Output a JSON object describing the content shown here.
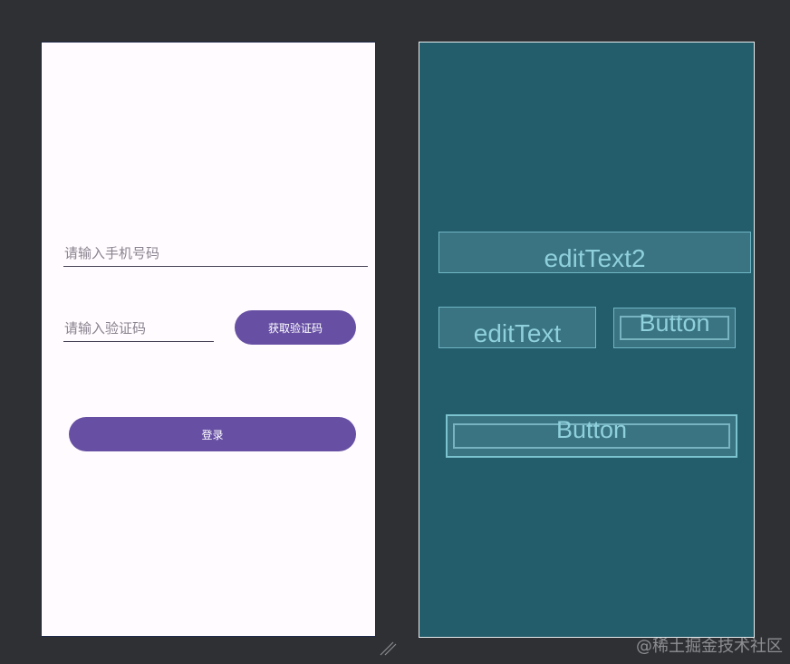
{
  "design": {
    "phone_placeholder": "请输入手机号码",
    "code_placeholder": "请输入验证码",
    "get_code_label": "获取验证码",
    "login_label": "登录",
    "accent_color": "#6750a4",
    "background_color": "#fffbfe"
  },
  "blueprint": {
    "edit_text2_label": "editText2",
    "edit_text_label": "editText",
    "button_small_label": "Button",
    "button_large_label": "Button",
    "background_color": "#235c6b"
  },
  "canvas": {
    "resize_handle_icon": "resize-handle-icon",
    "background_color": "#2f3033"
  },
  "watermark": "@稀土掘金技术社区"
}
